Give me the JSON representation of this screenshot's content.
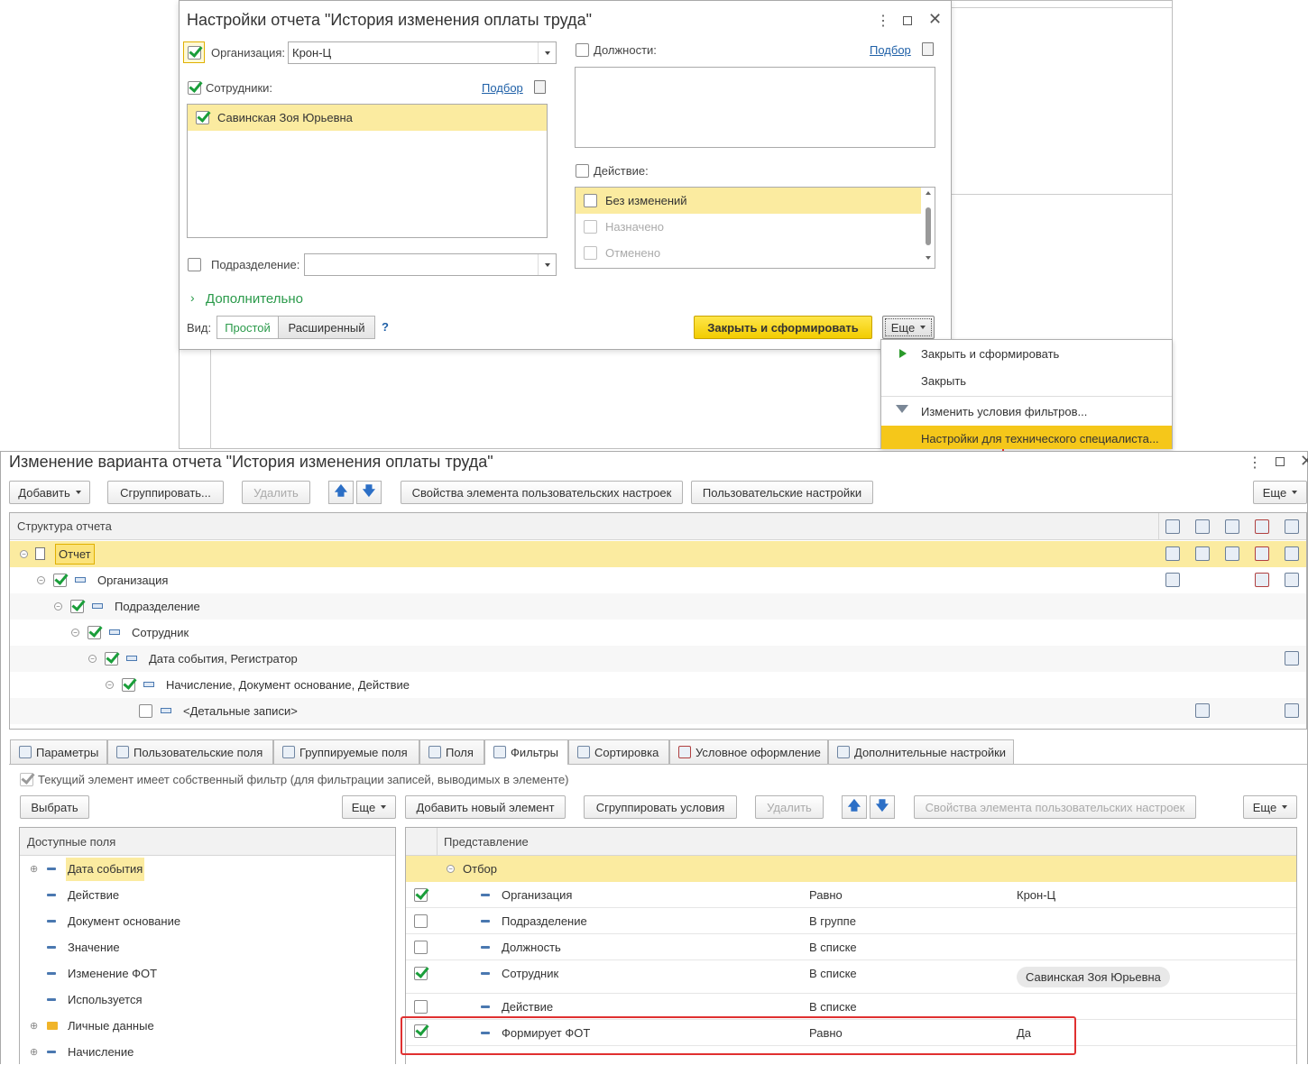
{
  "settings_dialog": {
    "title": "Настройки отчета \"История изменения оплаты труда\"",
    "org_label": "Организация:",
    "org_value": "Крон-Ц",
    "employees_label": "Сотрудники:",
    "pick_link": "Подбор",
    "employee_item": "Савинская Зоя Юрьевна",
    "dept_label": "Подразделение:",
    "positions_label": "Должности:",
    "positions_pick_link": "Подбор",
    "action_label": "Действие:",
    "action_items": [
      "Без изменений",
      "Назначено",
      "Отменено"
    ],
    "more_section": "Дополнительно",
    "view_label": "Вид:",
    "view_simple": "Простой",
    "view_extended": "Расширенный",
    "help": "?",
    "close_generate_btn": "Закрыть и сформировать",
    "more_btn": "Еще"
  },
  "dropdown_menu": {
    "items": [
      "Закрыть и сформировать",
      "Закрыть",
      "Изменить условия фильтров...",
      "Настройки для технического специалиста..."
    ]
  },
  "variant_window": {
    "title": "Изменение варианта отчета \"История изменения оплаты труда\"",
    "toolbar": {
      "add": "Добавить",
      "group": "Сгруппировать...",
      "delete": "Удалить",
      "item_props": "Свойства элемента пользовательских настроек",
      "user_settings": "Пользовательские настройки",
      "more": "Еще"
    },
    "structure_header": "Структура отчета",
    "tree": [
      "Отчет",
      "Организация",
      "Подразделение",
      "Сотрудник",
      "Дата события, Регистратор",
      "Начисление, Документ основание, Действие",
      "<Детальные записи>"
    ],
    "tabs": [
      "Параметры",
      "Пользовательские поля",
      "Группируемые поля",
      "Поля",
      "Фильтры",
      "Сортировка",
      "Условное оформление",
      "Дополнительные настройки"
    ],
    "own_filter_text": "Текущий элемент имеет собственный фильтр (для фильтрации записей, выводимых в элементе)",
    "left_toolbar": {
      "select": "Выбрать",
      "more": "Еще"
    },
    "right_toolbar": {
      "add_new": "Добавить новый элемент",
      "group_conditions": "Сгруппировать условия",
      "delete": "Удалить",
      "item_props": "Свойства элемента пользовательских настроек",
      "more": "Еще"
    },
    "available_fields_header": "Доступные поля",
    "available_fields": [
      "Дата события",
      "Действие",
      "Документ основание",
      "Значение",
      "Изменение ФОТ",
      "Используется",
      "Личные данные",
      "Начисление"
    ],
    "filter_header": "Представление",
    "filter_group": "Отбор",
    "filter_rows": [
      {
        "field": "Организация",
        "cond": "Равно",
        "value": "Крон-Ц",
        "checked": true
      },
      {
        "field": "Подразделение",
        "cond": "В группе",
        "value": "",
        "checked": false
      },
      {
        "field": "Должность",
        "cond": "В списке",
        "value": "",
        "checked": false
      },
      {
        "field": "Сотрудник",
        "cond": "В списке",
        "value": "Савинская Зоя Юрьевна",
        "checked": true
      },
      {
        "field": "Действие",
        "cond": "В списке",
        "value": "",
        "checked": false
      },
      {
        "field": "Формирует ФОТ",
        "cond": "Равно",
        "value": "Да",
        "checked": true
      }
    ]
  },
  "colors": {
    "accent_yellow": "#f5d000",
    "selection": "#fbeba0",
    "highlight_red": "#e03030",
    "green": "#1a9e3a"
  }
}
